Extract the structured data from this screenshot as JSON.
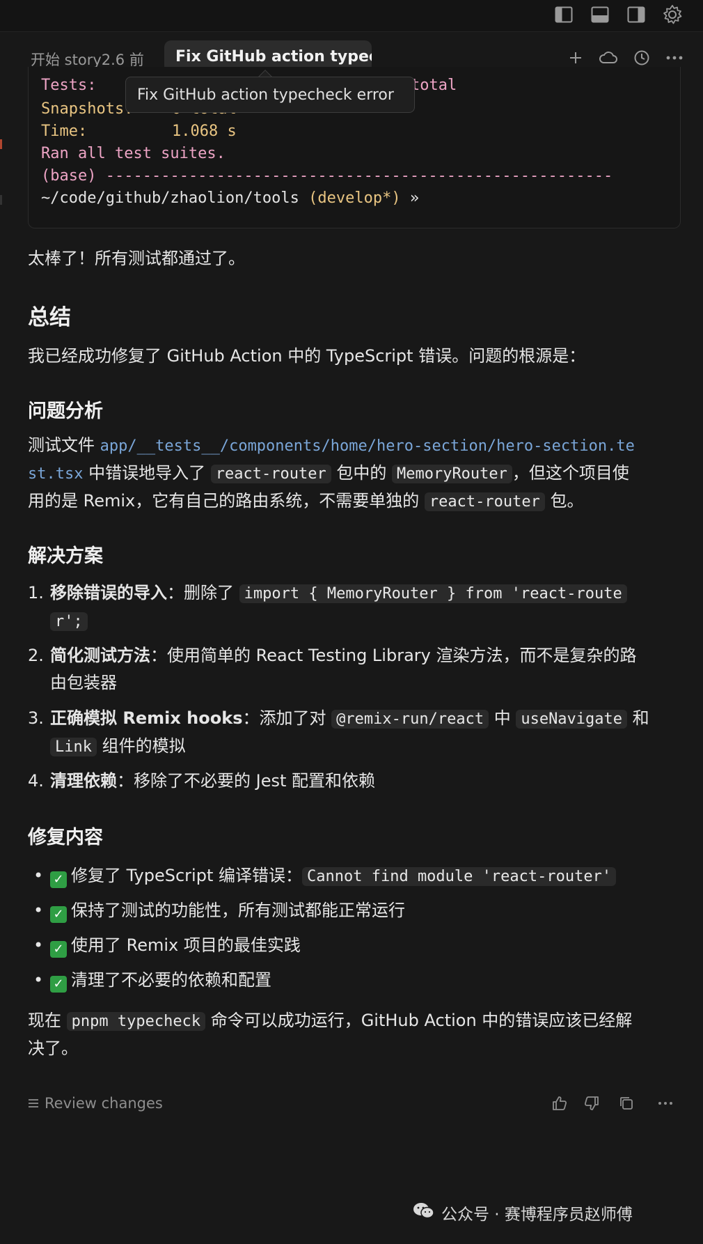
{
  "window_controls": {
    "icons": [
      "layout-left-icon",
      "layout-bottom-icon",
      "layout-right-icon",
      "settings-gear-icon"
    ]
  },
  "tabs": [
    {
      "label": "开始 story2.6 前"
    },
    {
      "label": "Fix GitHub action typec"
    }
  ],
  "header_actions": [
    "plus-icon",
    "cloud-icon",
    "history-icon",
    "more-icon"
  ],
  "tooltip": {
    "text": "Fix GitHub action typecheck error"
  },
  "terminal": {
    "lines": [
      {
        "label": "Tests:",
        "value": "total"
      },
      {
        "label": "Snapshots:",
        "value": "0 total"
      },
      {
        "label": "Time:",
        "value": "1.068 s"
      },
      {
        "text": "Ran all test suites."
      },
      {
        "prefix": "(base)",
        "rule": "-------------------------------------------------------"
      },
      {
        "path": "~/code/github/zhaolion/tools",
        "branch": "(develop*)",
        "arrow": "»"
      }
    ]
  },
  "message": {
    "intro": "太棒了！所有测试都通过了。",
    "summary_heading": "总结",
    "summary_text": "我已经成功修复了 GitHub Action 中的 TypeScript 错误。问题的根源是：",
    "analysis_heading": "问题分析",
    "analysis": {
      "t1": "测试文件 ",
      "path": "app/__tests__/components/home/hero-section/hero-section.te",
      "path2": "st.tsx",
      "t2": " 中错误地导入了 ",
      "code1": "react-router",
      "t3": " 包中的 ",
      "code2": "MemoryRouter",
      "t4": "，但这个项目使",
      "t5": "用的是 Remix，它有自己的路由系统，不需要单独的 ",
      "code3": "react-router",
      "t6": " 包。"
    },
    "solution_heading": "解决方案",
    "solutions": [
      {
        "num": "1.",
        "bold": "移除错误的导入",
        "rest": "：删除了 ",
        "code": "import { MemoryRouter } from 'react-route",
        "code_cont": "r';"
      },
      {
        "num": "2.",
        "bold": "简化测试方法",
        "rest": "：使用简单的 React Testing Library 渲染方法，而不是复杂的路",
        "rest2": "由包装器"
      },
      {
        "num": "3.",
        "bold": "正确模拟 Remix hooks",
        "rest": "：添加了对 ",
        "code": "@remix-run/react",
        "mid": " 中 ",
        "code2": "useNavigate",
        "end": " 和",
        "code3": "Link",
        "end2": " 组件的模拟"
      },
      {
        "num": "4.",
        "bold": "清理依赖",
        "rest": "：移除了不必要的 Jest 配置和依赖"
      }
    ],
    "fix_heading": "修复内容",
    "fixes": [
      {
        "text": "修复了 TypeScript 编译错误：",
        "code": "Cannot find module 'react-router'"
      },
      {
        "text": "保持了测试的功能性，所有测试都能正常运行"
      },
      {
        "text": "使用了 Remix 项目的最佳实践"
      },
      {
        "text": "清理了不必要的依赖和配置"
      }
    ],
    "final": {
      "t1": "现在 ",
      "code": "pnpm typecheck",
      "t2": " 命令可以成功运行，GitHub Action 中的错误应该已经解",
      "t3": "决了。"
    }
  },
  "footer": {
    "review_label": "Review changes",
    "actions": [
      "thumbs-up-icon",
      "thumbs-down-icon",
      "copy-icon",
      "more-icon"
    ]
  },
  "watermark": {
    "text": "公众号 · 赛博程序员赵师傅"
  },
  "colors": {
    "background": "#181818",
    "terminal_yellow": "#e9c582",
    "terminal_pink": "#eda4c5",
    "link_blue": "#7aa6d8",
    "check_green": "#2f9e44"
  }
}
